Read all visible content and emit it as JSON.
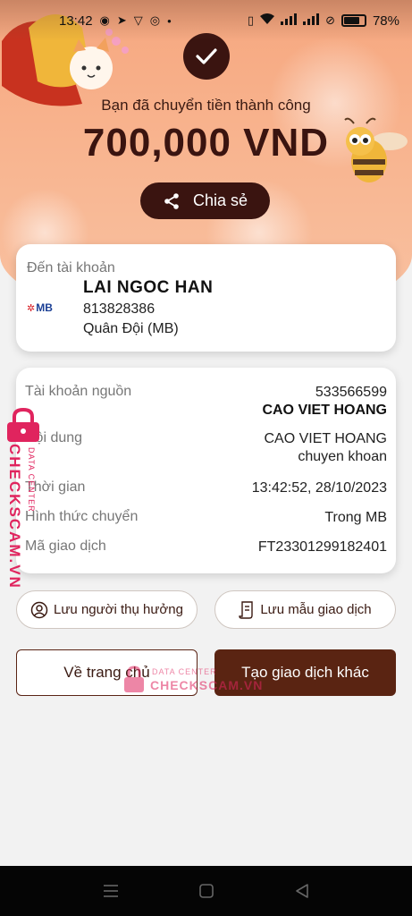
{
  "status_bar": {
    "time": "13:42",
    "battery": "78%",
    "battery_level": 0.78
  },
  "transfer": {
    "success_message": "Bạn đã chuyển tiền thành công",
    "amount": "700,000 VND",
    "share_label": "Chia sẻ"
  },
  "destination": {
    "label": "Đến tài khoản",
    "bank_logo": "MB",
    "name": "LAI NGOC HAN",
    "account_number": "813828386",
    "bank": "Quân Đội (MB)"
  },
  "details": {
    "source_label": "Tài khoản nguồn",
    "source_account": "533566599",
    "source_name": "CAO VIET HOANG",
    "content_label": "Nội dung",
    "content_line1": "CAO VIET HOANG",
    "content_line2": "chuyen khoan",
    "time_label": "Thời gian",
    "time_value": "13:42:52, 28/10/2023",
    "method_label": "Hình thức chuyển",
    "method_value": "Trong MB",
    "txn_label": "Mã giao dịch",
    "txn_value": "FT23301299182401"
  },
  "actions": {
    "save_beneficiary": "Lưu người thụ hưởng",
    "save_template": "Lưu mẫu giao dịch",
    "home": "Về trang chủ",
    "new_transaction": "Tạo giao dịch khác"
  },
  "watermark": {
    "brand": "CHECKSCAM.VN",
    "tagline": "DATA CENTER"
  },
  "colors": {
    "primary": "#3a1410",
    "button": "#5a2412",
    "hero": "#f6a77f",
    "watermark": "#e0245e"
  },
  "icons": [
    "check-icon",
    "share-icon",
    "user-circle-icon",
    "receipt-icon",
    "lock-icon",
    "menu-icon",
    "home-square-icon",
    "back-triangle-icon"
  ]
}
